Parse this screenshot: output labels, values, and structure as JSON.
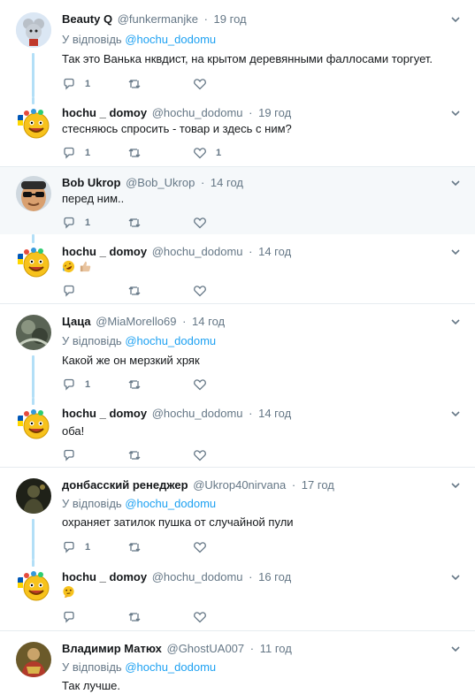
{
  "reply_prefix": "У відповідь",
  "tweets": [
    {
      "name": "Beauty Q",
      "handle": "@funkermanjke",
      "dot": "·",
      "time": "19 год",
      "reply_to": "@hochu_dodomu",
      "text": "Так это Ванька нквдист, на крытом деревянными фаллосами торгует.",
      "replies": "1",
      "retweets": "",
      "likes": ""
    },
    {
      "name": "hochu _ domoy",
      "handle": "@hochu_dodomu",
      "dot": "·",
      "time": "19 год",
      "text": "стесняюсь спросить - товар и здесь с ним?",
      "replies": "1",
      "retweets": "",
      "likes": "1"
    },
    {
      "name": "Bob Ukrop",
      "handle": "@Bob_Ukrop",
      "dot": "·",
      "time": "14 год",
      "text": "перед ним..",
      "replies": "1",
      "retweets": "",
      "likes": ""
    },
    {
      "name": "hochu _ domoy",
      "handle": "@hochu_dodomu",
      "dot": "·",
      "time": "14 год",
      "emoji": [
        "rofl-emoji",
        "thumbs-up-emoji"
      ],
      "replies": "",
      "retweets": "",
      "likes": ""
    },
    {
      "name": "Цаца",
      "handle": "@MiaMorello69",
      "dot": "·",
      "time": "14 год",
      "reply_to": "@hochu_dodomu",
      "text": "Какой же он мерзкий хряк",
      "replies": "1",
      "retweets": "",
      "likes": ""
    },
    {
      "name": "hochu _ domoy",
      "handle": "@hochu_dodomu",
      "dot": "·",
      "time": "14 год",
      "text": "оба!",
      "replies": "",
      "retweets": "",
      "likes": ""
    },
    {
      "name": "донбасский ренеджер",
      "handle": "@Ukrop40nirvana",
      "dot": "·",
      "time": "17 год",
      "reply_to": "@hochu_dodomu",
      "text": "охраняет затилок пушка от случайной пули",
      "replies": "1",
      "retweets": "",
      "likes": ""
    },
    {
      "name": "hochu _ domoy",
      "handle": "@hochu_dodomu",
      "dot": "·",
      "time": "16 год",
      "emoji": [
        "thinking-face-emoji"
      ],
      "replies": "",
      "retweets": "",
      "likes": ""
    },
    {
      "name": "Владимир Матюх",
      "handle": "@GhostUA007",
      "dot": "·",
      "time": "11 год",
      "reply_to": "@hochu_dodomu",
      "text": "Так лучше.",
      "replies": "",
      "retweets": "",
      "likes": ""
    }
  ],
  "colors": {
    "link": "#1da1f2",
    "muted": "#657786",
    "thread_line": "#b3dff7",
    "highlight_bg": "#f5f8fa"
  }
}
